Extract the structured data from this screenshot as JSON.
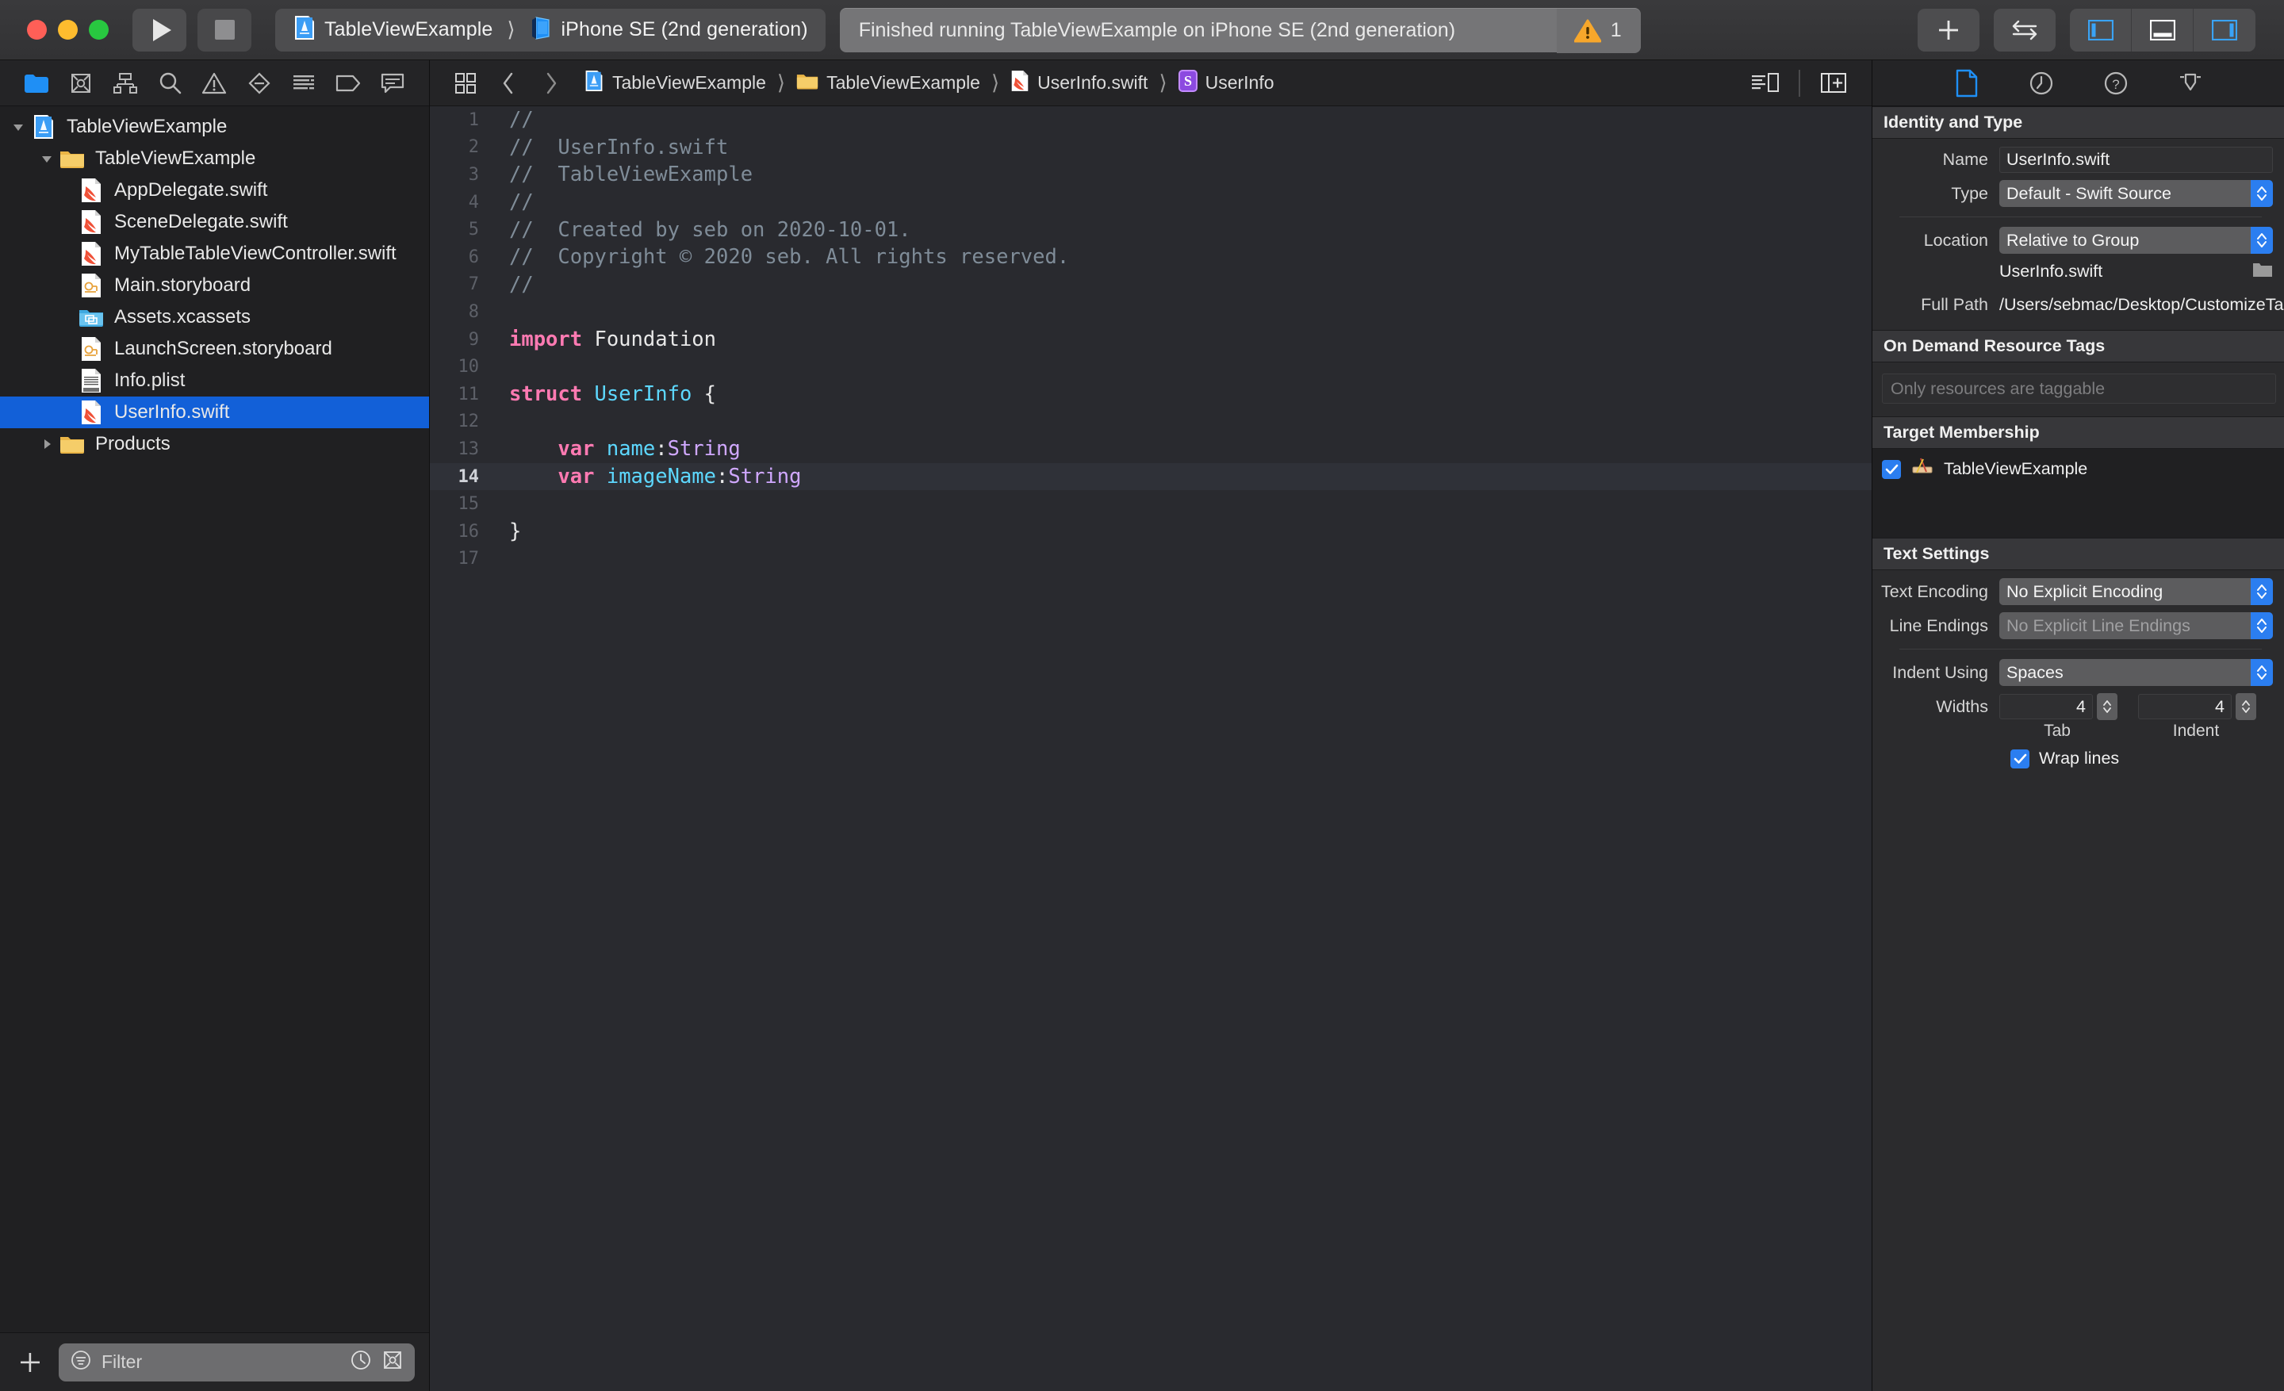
{
  "titlebar": {
    "run_button": "run-button",
    "stop_button": "stop-button",
    "scheme": "TableViewExample",
    "destination": "iPhone SE (2nd generation)",
    "status_text": "Finished running TableViewExample on iPhone SE (2nd generation)",
    "warning_count": "1",
    "add_label": "+",
    "right_buttons": [
      "add-button",
      "toggle-panels-button",
      "navigator-toggle",
      "debug-area-toggle",
      "inspector-toggle"
    ]
  },
  "navigator": {
    "toolbar_icons": [
      "project-navigator-icon",
      "source-control-navigator-icon",
      "symbol-navigator-icon",
      "find-navigator-icon",
      "issue-navigator-icon",
      "breakpoint-navigator-icon",
      "report-navigator-icon",
      "test-navigator-icon",
      "debug-navigator-icon"
    ],
    "tree": [
      {
        "label": "TableViewExample",
        "icon": "xcode-project-icon",
        "indent": 0,
        "twisty": "down",
        "selected": false
      },
      {
        "label": "TableViewExample",
        "icon": "folder-icon",
        "indent": 1,
        "twisty": "down",
        "selected": false
      },
      {
        "label": "AppDelegate.swift",
        "icon": "swift-file-icon",
        "indent": 2,
        "twisty": "none",
        "selected": false
      },
      {
        "label": "SceneDelegate.swift",
        "icon": "swift-file-icon",
        "indent": 2,
        "twisty": "none",
        "selected": false
      },
      {
        "label": "MyTableTableViewController.swift",
        "icon": "swift-file-icon",
        "indent": 2,
        "twisty": "none",
        "selected": false
      },
      {
        "label": "Main.storyboard",
        "icon": "storyboard-file-icon",
        "indent": 2,
        "twisty": "none",
        "selected": false
      },
      {
        "label": "Assets.xcassets",
        "icon": "assets-catalog-icon",
        "indent": 2,
        "twisty": "none",
        "selected": false
      },
      {
        "label": "LaunchScreen.storyboard",
        "icon": "storyboard-file-icon",
        "indent": 2,
        "twisty": "none",
        "selected": false
      },
      {
        "label": "Info.plist",
        "icon": "plist-file-icon",
        "indent": 2,
        "twisty": "none",
        "selected": false
      },
      {
        "label": "UserInfo.swift",
        "icon": "swift-file-icon",
        "indent": 2,
        "twisty": "none",
        "selected": true
      },
      {
        "label": "Products",
        "icon": "folder-icon",
        "indent": 1,
        "twisty": "right",
        "selected": false
      }
    ],
    "filter_placeholder": "Filter",
    "add_button": "+"
  },
  "editor": {
    "breadcrumb": [
      {
        "label": "TableViewExample",
        "icon": "xcode-project-icon"
      },
      {
        "label": "TableViewExample",
        "icon": "folder-icon"
      },
      {
        "label": "UserInfo.swift",
        "icon": "swift-file-icon"
      },
      {
        "label": "UserInfo",
        "icon": "swift-struct-icon"
      }
    ],
    "highlighted_line": 14,
    "code": [
      {
        "n": "1",
        "tokens": [
          {
            "t": "//",
            "c": "cm"
          }
        ]
      },
      {
        "n": "2",
        "tokens": [
          {
            "t": "//  UserInfo.swift",
            "c": "cm"
          }
        ]
      },
      {
        "n": "3",
        "tokens": [
          {
            "t": "//  TableViewExample",
            "c": "cm"
          }
        ]
      },
      {
        "n": "4",
        "tokens": [
          {
            "t": "//",
            "c": "cm"
          }
        ]
      },
      {
        "n": "5",
        "tokens": [
          {
            "t": "//  Created by seb on 2020-10-01.",
            "c": "cm"
          }
        ]
      },
      {
        "n": "6",
        "tokens": [
          {
            "t": "//  Copyright © 2020 seb. All rights reserved.",
            "c": "cm"
          }
        ]
      },
      {
        "n": "7",
        "tokens": [
          {
            "t": "//",
            "c": "cm"
          }
        ]
      },
      {
        "n": "8",
        "tokens": []
      },
      {
        "n": "9",
        "tokens": [
          {
            "t": "import",
            "c": "kw"
          },
          {
            "t": " Foundation",
            "c": "pl"
          }
        ]
      },
      {
        "n": "10",
        "tokens": []
      },
      {
        "n": "11",
        "tokens": [
          {
            "t": "struct",
            "c": "kw"
          },
          {
            "t": " ",
            "c": "pl"
          },
          {
            "t": "UserInfo",
            "c": "ty"
          },
          {
            "t": " {",
            "c": "pl"
          }
        ]
      },
      {
        "n": "12",
        "tokens": []
      },
      {
        "n": "13",
        "tokens": [
          {
            "t": "    ",
            "c": "pl"
          },
          {
            "t": "var",
            "c": "kw"
          },
          {
            "t": " ",
            "c": "pl"
          },
          {
            "t": "name",
            "c": "ty"
          },
          {
            "t": ":",
            "c": "pl"
          },
          {
            "t": "String",
            "c": "ty2"
          }
        ]
      },
      {
        "n": "14",
        "tokens": [
          {
            "t": "    ",
            "c": "pl"
          },
          {
            "t": "var",
            "c": "kw"
          },
          {
            "t": " ",
            "c": "pl"
          },
          {
            "t": "imageName",
            "c": "ty"
          },
          {
            "t": ":",
            "c": "pl"
          },
          {
            "t": "String",
            "c": "ty2"
          }
        ]
      },
      {
        "n": "15",
        "tokens": []
      },
      {
        "n": "16",
        "tokens": [
          {
            "t": "}",
            "c": "pl"
          }
        ]
      },
      {
        "n": "17",
        "tokens": []
      }
    ]
  },
  "inspector": {
    "tabs": [
      "file-inspector-icon",
      "history-inspector-icon",
      "quick-help-inspector-icon",
      "locking-inspector-icon"
    ],
    "identity": {
      "heading": "Identity and Type",
      "name_label": "Name",
      "name_value": "UserInfo.swift",
      "type_label": "Type",
      "type_value": "Default - Swift Source",
      "location_label": "Location",
      "location_value": "Relative to Group",
      "file_name": "UserInfo.swift",
      "full_path_label": "Full Path",
      "full_path_value": "/Users/sebmac/Desktop/CustomizeTableViewExample/TableViewExample/UserInfo.swift"
    },
    "ondemand": {
      "heading": "On Demand Resource Tags",
      "placeholder": "Only resources are taggable"
    },
    "target_membership": {
      "heading": "Target Membership",
      "item": "TableViewExample",
      "checked": true
    },
    "text_settings": {
      "heading": "Text Settings",
      "encoding_label": "Text Encoding",
      "encoding_value": "No Explicit Encoding",
      "line_endings_label": "Line Endings",
      "line_endings_value": "No Explicit Line Endings",
      "indent_label": "Indent Using",
      "indent_value": "Spaces",
      "widths_label": "Widths",
      "tab_width": "4",
      "indent_width": "4",
      "tab_sublabel": "Tab",
      "indent_sublabel": "Indent",
      "wrap_label": "Wrap lines",
      "wrap_checked": true
    }
  },
  "colors": {
    "accent_blue": "#2b7ef0",
    "selection_blue": "#1260d8",
    "warning_yellow": "#f7a72b",
    "editor_bg": "#292A2F",
    "keyword_pink": "#ff7ab2",
    "type_cyan": "#5dd8ff",
    "type_purple": "#d0a8ff",
    "comment_gray": "#7f8c98"
  }
}
